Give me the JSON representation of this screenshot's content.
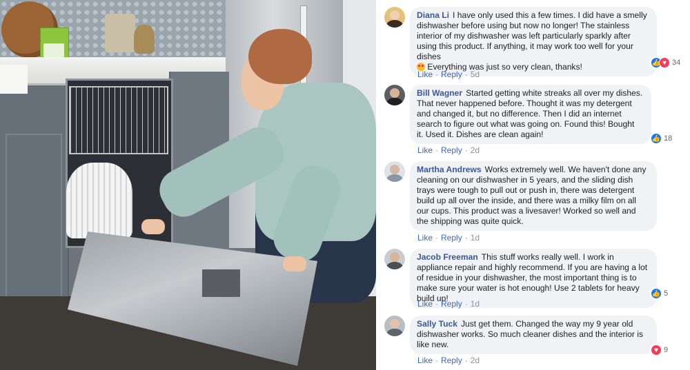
{
  "comments": [
    {
      "name": "Diana Li",
      "text": "I have only used this a few times. I did have a smelly dishwasher before using but now no longer! The stainless interior of my dishwasher was left particularly sparkly after using this product. If anything, it may work too well for your dishes",
      "text2": "Everything was just so very clean, thanks!",
      "like": "Like",
      "reply": "Reply",
      "time": "5d",
      "reaction_count": "34"
    },
    {
      "name": "Bill Wagner",
      "text": "Started getting white streaks all over my dishes. That never happened before. Thought it was my detergent and changed it, but no difference. Then I did an internet search to figure out what was going on. Found this! Bought it. Used it. Dishes are clean again!",
      "like": "Like",
      "reply": "Reply",
      "time": "2d",
      "reaction_count": "18"
    },
    {
      "name": "Martha Andrews",
      "text": "Works extremely well. We haven't done any cleaning on our dishwasher in 5 years, and the sliding dish trays were tough to pull out or push in, there was detergent build up all over the inside, and there was a milky film on all our cups. This product was a livesaver! Worked so well and the shipping was quite quick.",
      "like": "Like",
      "reply": "Reply",
      "time": "1d"
    },
    {
      "name": "Jacob Freeman",
      "text": "This stuff works really well. I work in appliance repair and highly recommend. If you are having a lot of residue in your dishwasher, the most important thing is to make sure your water is hot enough! Use 2 tablets for heavy build up!",
      "like": "Like",
      "reply": "Reply",
      "time": "1d",
      "reaction_count": "5"
    },
    {
      "name": "Sally Tuck",
      "text": "Just get them. Changed the way my 9 year old dishwasher works. So much cleaner dishes and the interior is like new.",
      "like": "Like",
      "reply": "Reply",
      "time": "2d",
      "reaction_count": "9"
    }
  ],
  "colors": {
    "name": "#385898",
    "link": "#4267b2",
    "bubble": "#f0f2f5",
    "like": "#1877f2",
    "love": "#f33e58"
  },
  "icons": [
    "like-icon",
    "love-icon",
    "heart-eyes-emoji-icon"
  ]
}
